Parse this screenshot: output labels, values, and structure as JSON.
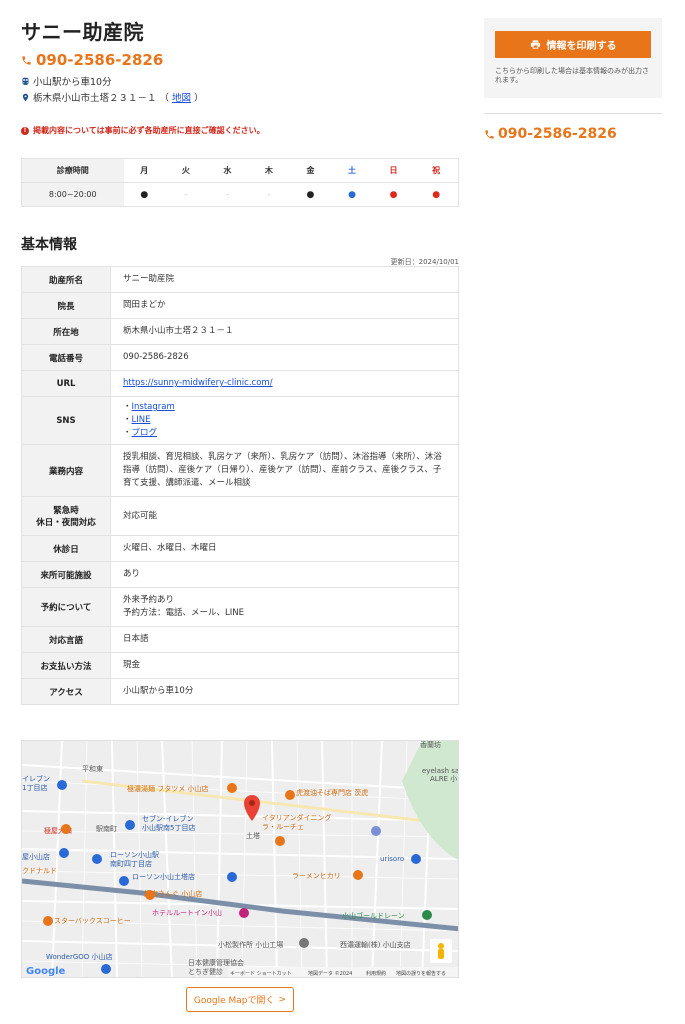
{
  "clinic": {
    "name": "サニー助産院",
    "phone": "090-2586-2826",
    "access": "小山駅から車10分",
    "address": "栃木県小山市土塔２３１－１",
    "map_paren_open": "（",
    "map_link": "地図",
    "map_paren_close": "）"
  },
  "notice": "掲載内容については事前に必ず各助産所に直接ご確認ください。",
  "hours": {
    "label_header": "診療時間",
    "days": [
      "月",
      "火",
      "水",
      "木",
      "金",
      "土",
      "日",
      "祝"
    ],
    "row_label": "8:00~20:00",
    "marks": [
      "●",
      "-",
      "-",
      "-",
      "●",
      "●",
      "●",
      "●"
    ]
  },
  "basic": {
    "title": "基本情報",
    "updated": "更新日：2024/10/01",
    "rows": [
      {
        "label": "助産所名",
        "value": "サニー助産院"
      },
      {
        "label": "院長",
        "value": "岡田まどか"
      },
      {
        "label": "所在地",
        "value": "栃木県小山市土塔２３１－１"
      },
      {
        "label": "電話番号",
        "value": "090-2586-2826"
      },
      {
        "label": "URL",
        "value": "https://sunny-midwifery-clinic.com/"
      },
      {
        "label": "SNS",
        "sns": [
          "Instagram",
          "LINE",
          "ブログ"
        ],
        "bullet": "・"
      },
      {
        "label": "業務内容",
        "value": "授乳相談、育児相談、乳房ケア（来所）、乳房ケア（訪問）、沐浴指導（来所）、沐浴指導（訪問）、産後ケア（日帰り）、産後ケア（訪問）、産前クラス、産後クラス、子育て支援、講師派遣、メール相談"
      },
      {
        "label1": "緊急時",
        "label2": "休日・夜間対応",
        "value": "対応可能"
      },
      {
        "label": "休診日",
        "value": "火曜日、水曜日、木曜日"
      },
      {
        "label": "来所可能施設",
        "value": "あり"
      },
      {
        "label": "予約について",
        "value1": "外来予約あり",
        "value2": "予約方法：電話、メール、LINE"
      },
      {
        "label": "対応言語",
        "value": "日本語"
      },
      {
        "label": "お支払い方法",
        "value": "現金"
      },
      {
        "label": "アクセス",
        "value": "小山駅から車10分"
      }
    ]
  },
  "map": {
    "labels": {
      "l1": "イレブン",
      "l2": "1丁目店",
      "l3": "極屋大和",
      "l4": "極濃湯麺 フタツメ 小山店",
      "l5": "セブン-イレブン",
      "l6": "小山駅南5丁目店",
      "l7": "駅南町",
      "l8": "イタリアンダイニング",
      "l9": "ラ・ルーチェ",
      "l10": "土塔",
      "l11": "ローソン小山駅",
      "l12": "南町四丁目店",
      "l13": "ローソン小山土塔店",
      "l14": "焼肉きんぐ 小山店",
      "l15": "ホテルルートイン小山",
      "l16": "スターバックスコーヒー",
      "l17": "小松製作所 小山工場",
      "l18": "西濃運輸(株) 小山支店",
      "l19": "小山ゴールドレーン",
      "l20": "ラーメンヒカリ",
      "l21": "urisoro",
      "l22": "WonderGOO 小山店",
      "l23": "日本健康管理協会",
      "l24": "とちぎ健診",
      "l25": "虎渡油そば専門店 茨虎",
      "l26": "eyelash sa",
      "l27": "ALRE 小",
      "l28": "屋小山店",
      "l29": "クドナルド",
      "l30": "Google",
      "l31": "キーボード ショートカット",
      "l32": "地図データ ©2024",
      "l33": "利用規約",
      "l34": "地図の誤りを報告する",
      "l35": "平和東",
      "l36": "香蘭坊"
    },
    "button": "Google Mapで開く",
    "button_arrow": ">"
  },
  "side": {
    "print_label": "情報を印刷する",
    "print_note": "こちらから印刷した場合は基本情報のみが出力されます。",
    "phone": "090-2586-2826"
  },
  "colors": {
    "accent": "#e8751a",
    "link": "#1a4fd6",
    "notice": "#d0281c",
    "sat": "#2a6ad6",
    "sun": "#d0281c"
  }
}
